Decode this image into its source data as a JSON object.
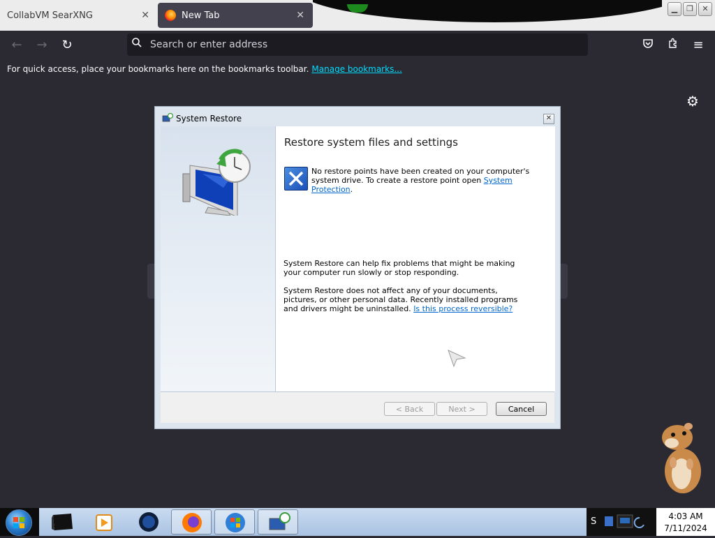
{
  "browser": {
    "tabs": [
      {
        "label": "CollabVM SearXNG",
        "close": "✕"
      },
      {
        "label": "New Tab",
        "close": "✕"
      }
    ],
    "urlbar_placeholder": "Search or enter address",
    "bookmarks_text": "For quick access, place your bookmarks here on the bookmarks toolbar.",
    "bookmarks_link": "Manage bookmarks..."
  },
  "dialog": {
    "title": "System Restore",
    "heading": "Restore system files and settings",
    "message_start": "No restore points have been created on your computer's system drive. To create a restore point open ",
    "message_link": "System Protection",
    "message_end": ".",
    "para1": "System Restore can help fix problems that might be making your computer run slowly or stop responding.",
    "para2_start": "System Restore does not affect any of your documents, pictures, or other personal data. Recently installed programs and drivers might be uninstalled. ",
    "para2_link": "Is this process reversible?",
    "buttons": {
      "back": "< Back",
      "next": "Next >",
      "cancel": "Cancel"
    }
  },
  "tray": {
    "text": "S"
  },
  "clock": {
    "time": "4:03 AM",
    "date": "7/11/2024"
  },
  "colors": {
    "accent_link": "#00ddff",
    "dialog_link": "#0066cc",
    "browser_bg": "#2b2a33"
  }
}
